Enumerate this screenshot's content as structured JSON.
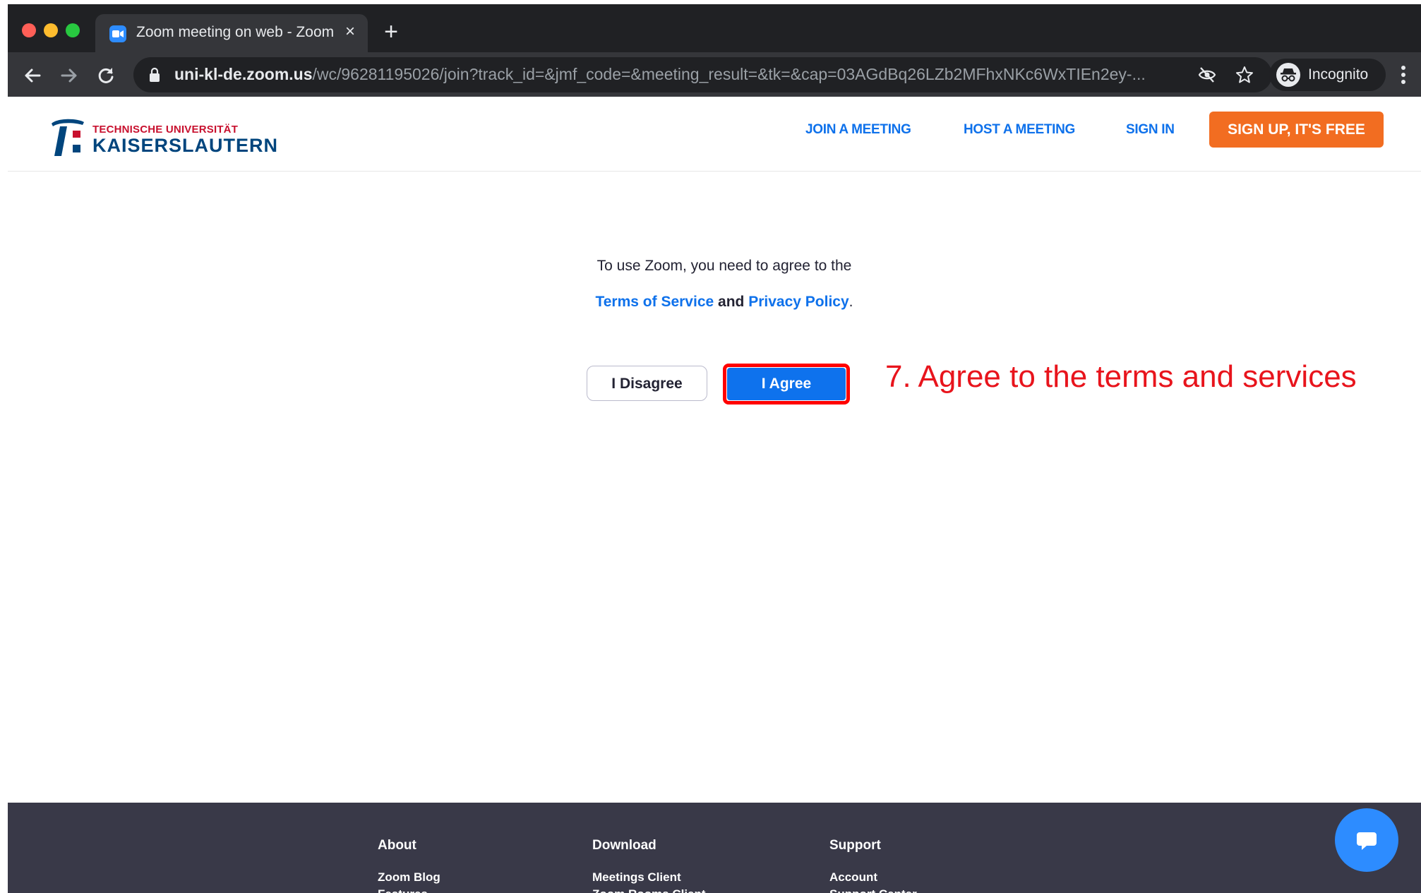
{
  "browser": {
    "tab_title": "Zoom meeting on web - Zoom",
    "tab_close": "×",
    "new_tab": "+",
    "url_host": "uni-kl-de.zoom.us",
    "url_path": "/wc/96281195026/join?track_id=&jmf_code=&meeting_result=&tk=&cap=03AGdBq26LZb2MFhxNKc6WxTIEn2ey-...",
    "incognito_label": "Incognito"
  },
  "header": {
    "logo_line1": "TECHNISCHE UNIVERSITÄT",
    "logo_line2": "KAISERSLAUTERN",
    "nav": {
      "join": "JOIN A MEETING",
      "host": "HOST A MEETING",
      "signin": "SIGN IN"
    },
    "signup": "SIGN UP, IT'S FREE"
  },
  "terms": {
    "line1": "To use Zoom, you need to agree to the",
    "tos_link": "Terms of Service",
    "and": "and",
    "privacy_link": "Privacy Policy",
    "period": ".",
    "disagree": "I Disagree",
    "agree": "I Agree"
  },
  "annotation": "7. Agree to the terms and services",
  "footer": {
    "about": {
      "heading": "About",
      "items": [
        "Zoom Blog",
        "Features"
      ]
    },
    "download": {
      "heading": "Download",
      "items": [
        "Meetings Client",
        "Zoom Rooms Client"
      ]
    },
    "support": {
      "heading": "Support",
      "items": [
        "Account",
        "Support Center"
      ]
    }
  },
  "colors": {
    "zoom_blue": "#0e71eb",
    "signup_orange": "#f26d21",
    "annotation_red": "#e8141c",
    "footer_bg": "#393948"
  }
}
